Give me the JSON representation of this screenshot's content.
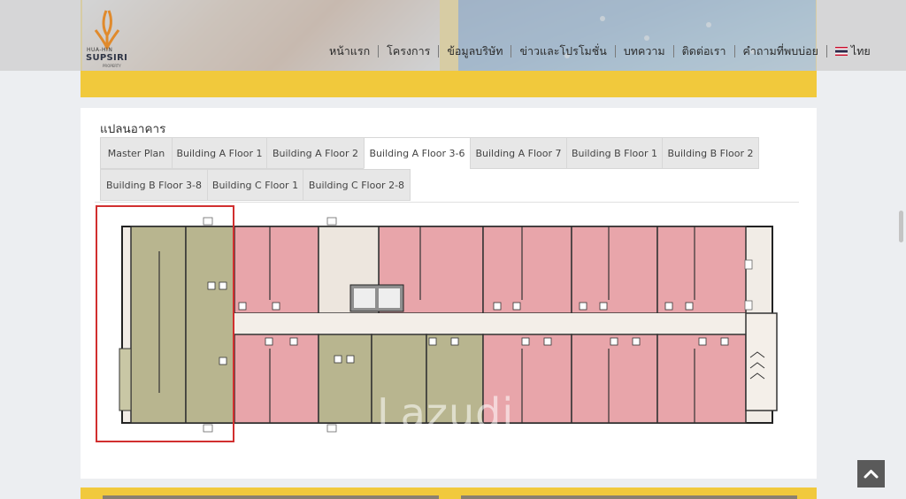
{
  "logo": {
    "small_text": "HUA-HIN",
    "main_text": "SUPSIRI",
    "sub_text": "PROPERTY"
  },
  "nav": {
    "items": [
      "หน้าแรก",
      "โครงการ",
      "ข้อมูลบริษัท",
      "ข่าวและโปรโมชั่น",
      "บทความ",
      "ติดต่อเรา",
      "คำถามที่พบบ่อย"
    ],
    "language": "ไทย"
  },
  "section": {
    "title": "แปลนอาคาร"
  },
  "tabs": [
    "Master Plan",
    "Building A Floor 1",
    "Building A Floor 2",
    "Building A Floor 3-6",
    "Building A Floor 7",
    "Building B Floor 1",
    "Building B Floor 2",
    "Building B Floor 3-8",
    "Building C Floor 1",
    "Building C Floor 2-8"
  ],
  "active_tab": "Building A Floor 3-6",
  "watermark": "Lazudi",
  "colors": {
    "brand_yellow": "#f1c93c",
    "unit_red": "#e8a5aa",
    "unit_olive": "#b8b58f",
    "corridor": "#f0ebe4",
    "highlight_red": "#d12f2f"
  },
  "icons": {
    "back_to_top": "chevron-up-icon",
    "language_flag": "thai-flag-icon"
  }
}
